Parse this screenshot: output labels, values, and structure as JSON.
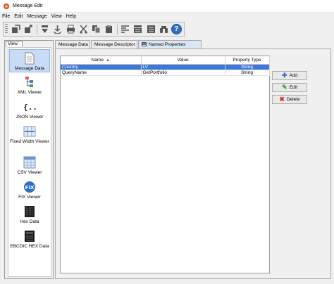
{
  "window": {
    "title": "Message Edit"
  },
  "menu": [
    "File",
    "Edit",
    "Message",
    "View",
    "Help"
  ],
  "toolbar": {
    "icons": [
      "open-icon",
      "save-icon",
      "import-icon",
      "export-icon",
      "print-icon",
      "cut-icon",
      "copy-icon",
      "paste-icon",
      "format-icon",
      "align-icon",
      "layout-icon",
      "find-icon",
      "help-icon"
    ],
    "help_glyph": "?"
  },
  "sidebar": {
    "tab": "View",
    "items": [
      {
        "label": "Message Data",
        "icon": "document-icon"
      },
      {
        "label": "XML Viewer",
        "icon": "xml-tree-icon"
      },
      {
        "label": "JSON Viewer",
        "icon": "json-braces-icon"
      },
      {
        "label": "Fixed Width Viewer",
        "icon": "fixed-width-icon"
      },
      {
        "label": "CSV Viewer",
        "icon": "csv-grid-icon"
      },
      {
        "label": "FIX Viewer",
        "icon": "fix-badge-icon"
      },
      {
        "label": "Hex Data",
        "icon": "hex-binary-icon"
      },
      {
        "label": "EBCDIC HEX Data",
        "icon": "ebcdic-icon"
      }
    ],
    "fix_badge": "FIX"
  },
  "tabs": [
    {
      "label": "Message Data"
    },
    {
      "label": "Message Descriptor"
    },
    {
      "label": "Named Properties"
    }
  ],
  "table": {
    "columns": [
      "Name",
      "Value",
      "Property Type"
    ],
    "rows": [
      {
        "name": "Country",
        "value": "LV",
        "type": "String"
      },
      {
        "name": "QueryName",
        "value": "GetPortfolio",
        "type": "String"
      }
    ]
  },
  "actions": {
    "add": "Add",
    "edit": "Edit",
    "delete": "Delete"
  },
  "colors": {
    "selection": "#3c78d8",
    "add_icon": "#2f6fc4",
    "edit_icon": "#3b9b3b",
    "delete_icon": "#d03030"
  }
}
